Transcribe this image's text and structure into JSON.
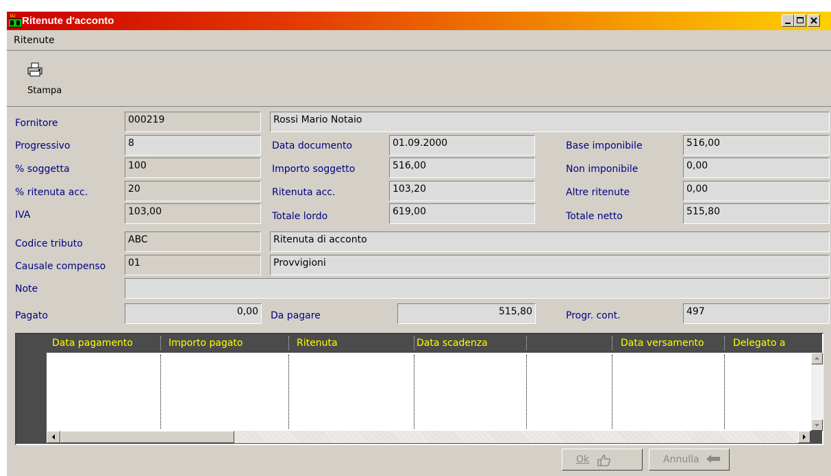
{
  "window": {
    "title": "Ritenute d'acconto",
    "title_color": "#ffffff",
    "titlebar_gradient": [
      "#cc0000",
      "#ffd000"
    ]
  },
  "menu": {
    "items": [
      "Ritenute"
    ]
  },
  "toolbar": {
    "print_label": "Stampa",
    "print_icon": "printer-icon"
  },
  "form": {
    "fornitore": {
      "label": "Fornitore",
      "code": "000219",
      "name": "Rossi Mario Notaio"
    },
    "progressivo": {
      "label": "Progressivo",
      "value": "8"
    },
    "perc_soggetta": {
      "label": "% soggetta",
      "value": "100"
    },
    "perc_ritenuta": {
      "label": "% ritenuta acc.",
      "value": "20"
    },
    "iva": {
      "label": "IVA",
      "value": "103,00"
    },
    "data_documento": {
      "label": "Data documento",
      "value": "01.09.2000"
    },
    "importo_soggetto": {
      "label": "Importo soggetto",
      "value": "516,00"
    },
    "ritenuta_acc": {
      "label": "Ritenuta acc.",
      "value": "103,20"
    },
    "totale_lordo": {
      "label": "Totale lordo",
      "value": "619,00"
    },
    "base_imponibile": {
      "label": "Base imponibile",
      "value": "516,00"
    },
    "non_imponibile": {
      "label": "Non imponibile",
      "value": "0,00"
    },
    "altre_ritenute": {
      "label": "Altre ritenute",
      "value": "0,00"
    },
    "totale_netto": {
      "label": "Totale netto",
      "value": "515,80"
    },
    "codice_tributo": {
      "label": "Codice tributo",
      "code": "ABC",
      "description": "Ritenuta di acconto"
    },
    "causale_compenso": {
      "label": "Causale compenso",
      "code": "01",
      "description": "Provvigioni"
    },
    "note": {
      "label": "Note",
      "value": ""
    },
    "pagato": {
      "label": "Pagato",
      "value": "0,00"
    },
    "da_pagare": {
      "label": "Da pagare",
      "value": "515,80"
    },
    "progr_cont": {
      "label": "Progr. cont.",
      "value": "497"
    }
  },
  "grid": {
    "columns": [
      "Data pagamento",
      "Importo pagato",
      "Ritenuta",
      "Data scadenza",
      "",
      "Data versamento",
      "Delegato a"
    ],
    "rows": [],
    "header_text_color": "#ffff00"
  },
  "buttons": {
    "ok": "Ok",
    "annulla": "Annulla"
  }
}
